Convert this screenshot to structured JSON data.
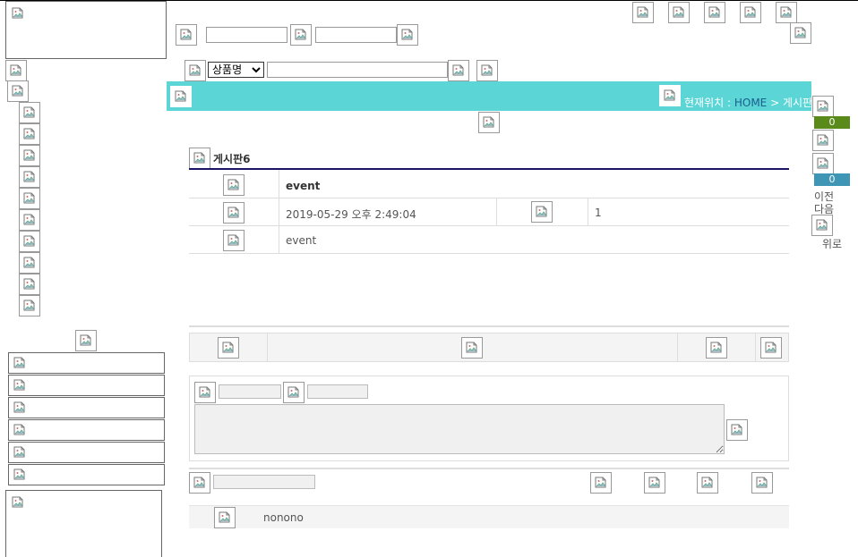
{
  "search": {
    "category_selected": "상품명",
    "category_options": [
      "상품명"
    ]
  },
  "location": {
    "prefix": "현재위치 : ",
    "home": "HOME",
    "separator": " > ",
    "current": "게시판"
  },
  "quick": {
    "cart_count": "0",
    "wish_count": "0",
    "prev": "이전",
    "next": "다음",
    "top": "위로",
    "cart_badge_color": "#5a8a1a",
    "wish_badge_color": "#3e96b4"
  },
  "post": {
    "board_name": "게시판6",
    "subject": "event",
    "date": "2019-05-29 오후 2:49:04",
    "hits": "1",
    "content": "event"
  },
  "comment": {
    "author": "nonono"
  },
  "colors": {
    "banner": "#5bd5d5",
    "title_line": "#1b1464"
  }
}
